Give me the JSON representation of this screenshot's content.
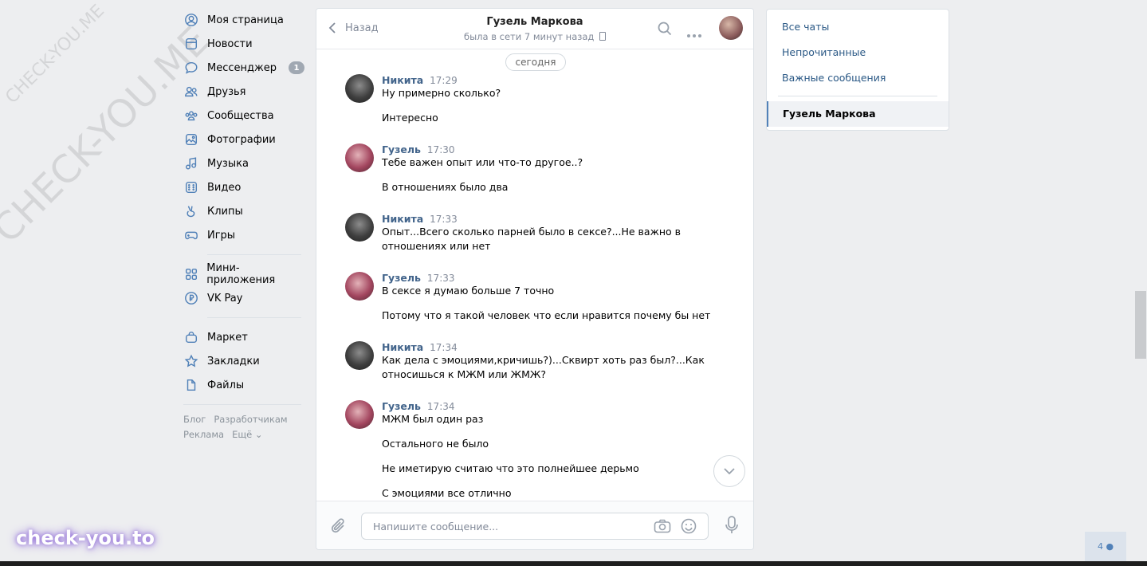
{
  "nav": {
    "items": [
      {
        "label": "Моя страница",
        "icon": "user-circle-icon"
      },
      {
        "label": "Новости",
        "icon": "news-icon"
      },
      {
        "label": "Мессенджер",
        "icon": "chat-bubble-icon",
        "badge": "1"
      },
      {
        "label": "Друзья",
        "icon": "friends-icon"
      },
      {
        "label": "Сообщества",
        "icon": "groups-icon"
      },
      {
        "label": "Фотографии",
        "icon": "photo-icon"
      },
      {
        "label": "Музыка",
        "icon": "music-icon"
      },
      {
        "label": "Видео",
        "icon": "video-icon"
      },
      {
        "label": "Клипы",
        "icon": "clips-icon"
      },
      {
        "label": "Игры",
        "icon": "gamepad-icon"
      }
    ],
    "items2": [
      {
        "label": "Мини-приложения",
        "icon": "apps-icon"
      },
      {
        "label": "VK Pay",
        "icon": "vkpay-icon"
      }
    ],
    "items3": [
      {
        "label": "Маркет",
        "icon": "bag-icon"
      },
      {
        "label": "Закладки",
        "icon": "star-icon"
      },
      {
        "label": "Файлы",
        "icon": "file-icon"
      }
    ],
    "footer": {
      "blog": "Блог",
      "dev": "Разработчикам",
      "ads": "Реклама",
      "more": "Ещё ⌄"
    }
  },
  "chat": {
    "back_label": "Назад",
    "title": "Гузель Маркова",
    "subtitle": "была в сети 7 минут назад",
    "date_pill": "сегодня",
    "messages": [
      {
        "name": "Никита",
        "time": "17:29",
        "lines": [
          "Ну примерно сколько?",
          "",
          "Интересно"
        ]
      },
      {
        "name": "Гузель",
        "time": "17:30",
        "lines": [
          "Тебе важен опыт или что-то другое..?",
          "",
          "В отношениях было два"
        ]
      },
      {
        "name": "Никита",
        "time": "17:33",
        "lines": [
          "Опыт...Всего сколько парней было в сексе?...Не важно в",
          "отношениях или нет"
        ]
      },
      {
        "name": "Гузель",
        "time": "17:33",
        "lines": [
          "В сексе я думаю больше 7 точно",
          "",
          "Потому что я такой человек что если нравится почему бы нет"
        ]
      },
      {
        "name": "Никита",
        "time": "17:34",
        "lines": [
          "Как дела с эмоциями,кричишь?)...Сквирт хоть раз был?...Как",
          "относишься к МЖМ или ЖМЖ?"
        ]
      },
      {
        "name": "Гузель",
        "time": "17:34",
        "lines": [
          "МЖМ был один раз",
          "",
          "Остального не было",
          "",
          "Не иметирую считаю что это полнейшее дерьмо",
          "",
          "С эмоциями все отлично"
        ]
      }
    ],
    "input_placeholder": "Напишите сообщение..."
  },
  "right_panel": {
    "all_chats": "Все чаты",
    "unread": "Непрочитанные",
    "important": "Важные сообщения",
    "active_chat": "Гузель Маркова"
  },
  "watermarks": {
    "small": "CHECK-YOU.ME",
    "large": "CHECK-YOU.ME",
    "brand": "check-you.to"
  },
  "online_count": "4"
}
